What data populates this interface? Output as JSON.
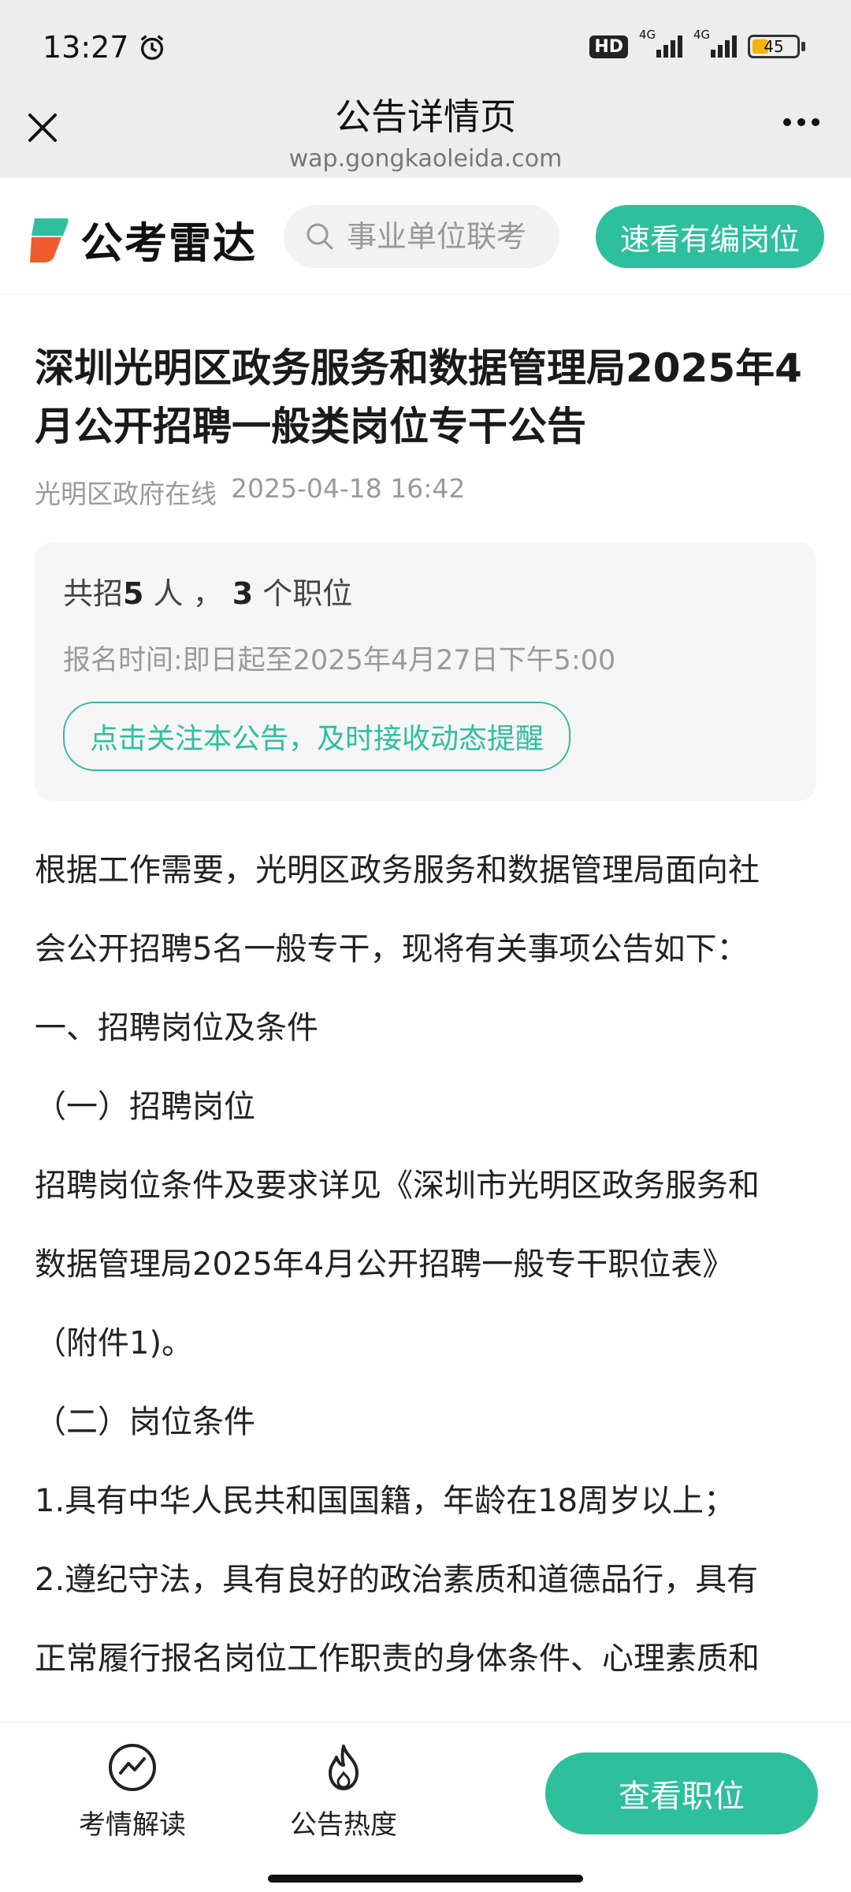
{
  "status_bar": {
    "time": "13:27",
    "hd_label": "HD",
    "network1": "4G",
    "network2": "4G",
    "battery": "45"
  },
  "topbar": {
    "title": "公告详情页",
    "url": "wap.gongkaoleida.com"
  },
  "site_header": {
    "logo_text": "公考雷达",
    "search_placeholder": "事业单位联考",
    "cta_label": "速看有编岗位",
    "brand_color": "#2ebf9d"
  },
  "article": {
    "title": "深圳光明区政务服务和数据管理局2025年4月公开招聘一般类岗位专干公告",
    "source": "光明区政府在线",
    "date": "2025-04-18 16:42",
    "info": {
      "prefix": "共招",
      "people": "5",
      "people_unit": " 人 ，",
      "positions": "3",
      "positions_unit": " 个职位",
      "registration_time": "报名时间:即日起至2025年4月27日下午5:00",
      "follow_label": "点击关注本公告，及时接收动态提醒"
    },
    "paragraphs": [
      "根据工作需要，光明区政务服务和数据管理局面向社",
      "会公开招聘5名一般专干，现将有关事项公告如下：",
      "一、招聘岗位及条件",
      "（一）招聘岗位",
      "招聘岗位条件及要求详见《深圳市光明区政务服务和",
      "数据管理局2025年4月公开招聘一般专干职位表》",
      "（附件1)。",
      "（二）岗位条件",
      "1.具有中华人民共和国国籍，年龄在18周岁以上；",
      "2.遵纪守法，具有良好的政治素质和道德品行，具有",
      "正常履行报名岗位工作职责的身体条件、心理素质和"
    ]
  },
  "bottom_bar": {
    "item1_label": "考情解读",
    "item2_label": "公告热度",
    "view_positions_label": "查看职位"
  }
}
